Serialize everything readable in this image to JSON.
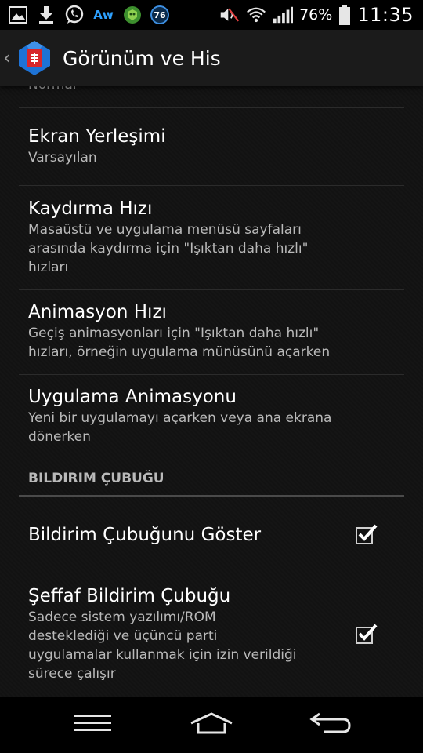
{
  "status_bar": {
    "notification_icons": [
      "image-icon",
      "download-icon",
      "whatsapp-icon",
      "aw-icon",
      "game-icon",
      "badge-76-icon"
    ],
    "aw_label": "Aw",
    "badge_label": "76",
    "battery_percent": "76%",
    "time": "11:35"
  },
  "action_bar": {
    "title": "Görünüm ve His"
  },
  "preferences": {
    "partial_summary": "Normal",
    "screen_layout": {
      "title": "Ekran Yerleşimi",
      "summary": "Varsayılan"
    },
    "scroll_speed": {
      "title": "Kaydırma Hızı",
      "summary_1": "Masaüstü ve uygulama menüsü sayfaları",
      "summary_2": "arasında kaydırma için \"Işıktan daha hızlı\"",
      "summary_3": "hızları"
    },
    "animation_speed": {
      "title": "Animasyon Hızı",
      "summary_1": "Geçiş animasyonları için \"Işıktan daha hızlı\"",
      "summary_2": "hızları, örneğin uygulama münüsünü açarken"
    },
    "app_animation": {
      "title": "Uygulama Animasyonu",
      "summary_1": "Yeni bir uygulamayı açarken veya ana ekrana",
      "summary_2": "dönerken"
    }
  },
  "notification_section": {
    "header": "BILDIRIM ÇUBUĞU",
    "show_bar": {
      "title": "Bildirim Çubuğunu Göster",
      "checked": true
    },
    "transparent_bar": {
      "title": "Şeffaf Bildirim Çubuğu",
      "summary_1": "Sadece sistem yazılımı/ROM",
      "summary_2": "desteklediği ve üçüncü parti",
      "summary_3": "uygulamalar kullanmak için izin verildiği",
      "summary_4": "sürece çalışır",
      "checked": true
    }
  },
  "colors": {
    "accent_blue": "#2ea1ff",
    "logo_red": "#d8262b",
    "logo_blue": "#1e73d6"
  },
  "nav_bar": {
    "icons": [
      "menu-icon",
      "home-icon",
      "back-icon"
    ]
  }
}
